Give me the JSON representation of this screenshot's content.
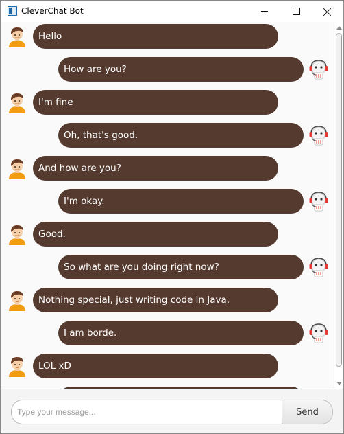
{
  "window": {
    "title": "CleverChat Bot"
  },
  "messages": [
    {
      "sender": "user",
      "text": "Hello"
    },
    {
      "sender": "bot",
      "text": "How are you?"
    },
    {
      "sender": "user",
      "text": "I'm fine"
    },
    {
      "sender": "bot",
      "text": "Oh, that's good."
    },
    {
      "sender": "user",
      "text": "And how are you?"
    },
    {
      "sender": "bot",
      "text": "I'm okay."
    },
    {
      "sender": "user",
      "text": "Good."
    },
    {
      "sender": "bot",
      "text": "So what are you doing right now?"
    },
    {
      "sender": "user",
      "text": "Nothing special, just writing code in Java."
    },
    {
      "sender": "bot",
      "text": "I am borde."
    },
    {
      "sender": "user",
      "text": "LOL xD"
    },
    {
      "sender": "bot",
      "text": ""
    }
  ],
  "composer": {
    "placeholder": "Type your message...",
    "send_label": "Send"
  },
  "colors": {
    "bubble": "#553b2f",
    "bubble_text": "#ffffff",
    "bot_headset": "#e53935"
  },
  "icons": {
    "user_avatar": "user-avatar-icon",
    "bot_avatar": "robot-avatar-icon"
  }
}
